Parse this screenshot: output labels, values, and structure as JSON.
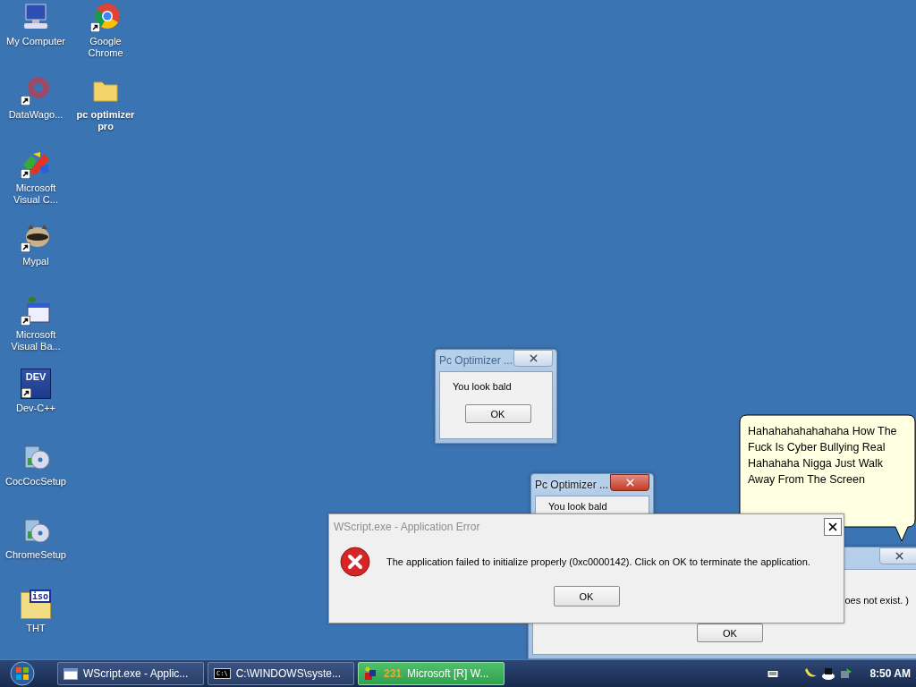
{
  "desktop_icons": [
    {
      "label": "My Computer",
      "kind": "computer",
      "shortcut": false,
      "bold": false
    },
    {
      "label": "DataWago...",
      "kind": "disc",
      "shortcut": true,
      "bold": false
    },
    {
      "label": "Microsoft Visual C...",
      "kind": "studio",
      "shortcut": true,
      "bold": false
    },
    {
      "label": "Mypal",
      "kind": "raccoon",
      "shortcut": true,
      "bold": false
    },
    {
      "label": "Microsoft Visual Ba...",
      "kind": "basic",
      "shortcut": true,
      "bold": false
    },
    {
      "label": "Dev-C++",
      "kind": "dev",
      "shortcut": true,
      "bold": false
    },
    {
      "label": "CocCocSetup",
      "kind": "installer",
      "shortcut": false,
      "bold": false
    },
    {
      "label": "ChromeSetup",
      "kind": "installer",
      "shortcut": false,
      "bold": false
    },
    {
      "label": "THT",
      "kind": "iso",
      "shortcut": false,
      "bold": false
    },
    {
      "label": "Google Chrome",
      "kind": "chrome",
      "shortcut": true,
      "bold": false
    },
    {
      "label": "pc optimizer pro",
      "kind": "folder",
      "shortcut": false,
      "bold": true
    }
  ],
  "dev_icon_text": "DEV",
  "iso_icon_text": "iso",
  "popups": [
    {
      "title": "Pc Optimizer ...",
      "message": "You look bald",
      "button": "OK",
      "active": false
    },
    {
      "title": "Pc Optimizer ...",
      "message": "You look bald",
      "active": true
    },
    {
      "message": "oes not exist. )",
      "button": "OK",
      "active": false
    }
  ],
  "speech_bubble": {
    "text": "Hahahahahahahaha How The Fuck Is Cyber Bullying Real Hahahaha Nigga Just Walk Away From The Screen"
  },
  "error_dialog": {
    "title": "WScript.exe - Application Error",
    "message": "The application failed to initialize properly (0xc0000142). Click on OK to terminate the application.",
    "button": "OK"
  },
  "taskbar": {
    "buttons": [
      {
        "label": "WScript.exe - Applic...",
        "kind": "window",
        "selected": false
      },
      {
        "label": "C:\\WINDOWS\\syste...",
        "kind": "console",
        "icon_text": "C:\\",
        "selected": false
      },
      {
        "label": "Microsoft [R] W...",
        "badge": "231",
        "kind": "app",
        "selected": true
      }
    ],
    "clock": "8:50 AM"
  }
}
